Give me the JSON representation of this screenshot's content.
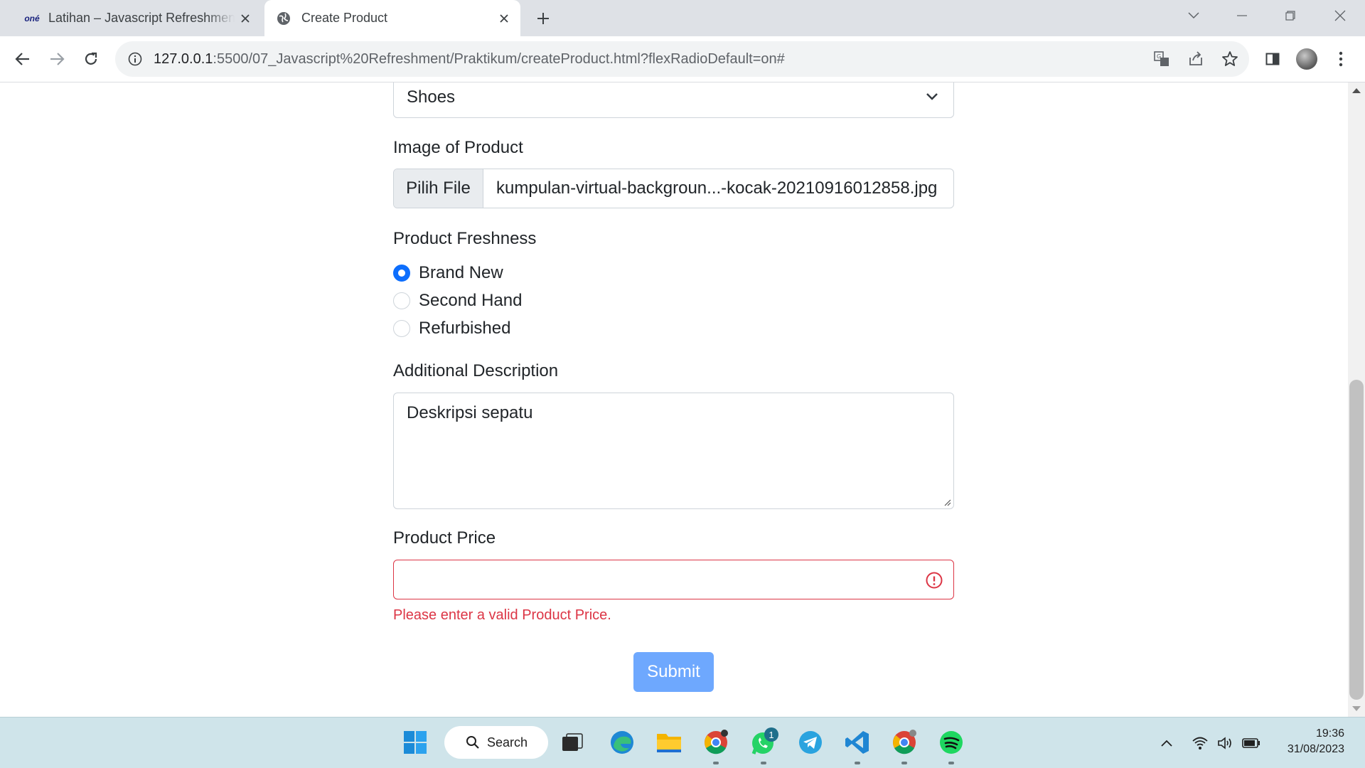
{
  "browser": {
    "tabs": [
      {
        "title": "Latihan – Javascript Refreshment",
        "favicon": "one-logo-icon",
        "favicon_text": "oné",
        "active": false
      },
      {
        "title": "Create Product",
        "favicon": "globe-icon",
        "active": true
      }
    ],
    "url_host": "127.0.0.1",
    "url_path": ":5500/07_Javascript%20Refreshment/Praktikum/createProduct.html?flexRadioDefault=on#"
  },
  "form": {
    "category_value": "Shoes",
    "image_label": "Image of Product",
    "file_button": "Pilih File",
    "file_name": "kumpulan-virtual-backgroun...-kocak-20210916012858.jpg",
    "freshness_label": "Product Freshness",
    "freshness_options": [
      {
        "label": "Brand New",
        "checked": true
      },
      {
        "label": "Second Hand",
        "checked": false
      },
      {
        "label": "Refurbished",
        "checked": false
      }
    ],
    "description_label": "Additional Description",
    "description_value": "Deskripsi sepatu",
    "price_label": "Product Price",
    "price_value": "",
    "price_error": "Please enter a valid Product Price.",
    "submit_label": "Submit"
  },
  "taskbar": {
    "search_label": "Search",
    "whatsapp_badge": "1",
    "time": "19:36",
    "date": "31/08/2023"
  },
  "colors": {
    "primary": "#0d6efd",
    "submit_disabled": "#6ea8fe",
    "danger": "#dc3545",
    "taskbar": "#cfe4ea"
  }
}
